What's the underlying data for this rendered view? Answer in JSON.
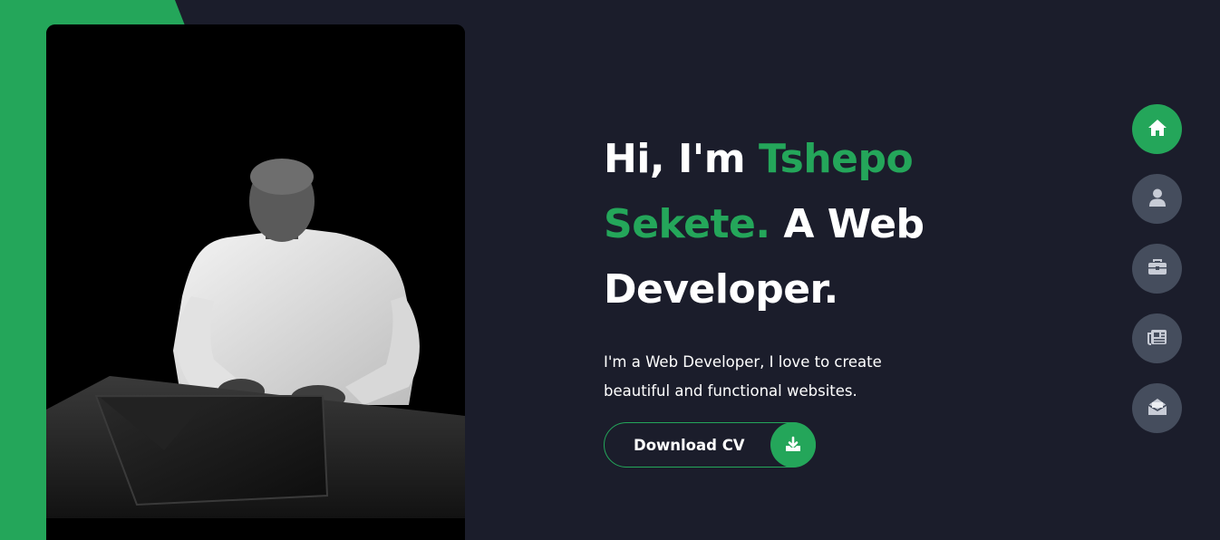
{
  "colors": {
    "accent": "#24a65a",
    "background": "#1b1d2b",
    "nav_inactive": "#454d5d",
    "text": "#ffffff"
  },
  "hero": {
    "greeting": "Hi, I'm",
    "name": "Tshepo Sekete.",
    "role": "A Web Developer.",
    "tagline": "I'm a Web Developer, I love to create beautiful and functional websites."
  },
  "cv_button": {
    "label": "Download CV",
    "icon": "download-icon"
  },
  "side_nav": [
    {
      "icon": "home-icon",
      "active": true
    },
    {
      "icon": "user-icon",
      "active": false
    },
    {
      "icon": "briefcase-icon",
      "active": false
    },
    {
      "icon": "newspaper-icon",
      "active": false
    },
    {
      "icon": "envelope-open-icon",
      "active": false
    }
  ]
}
